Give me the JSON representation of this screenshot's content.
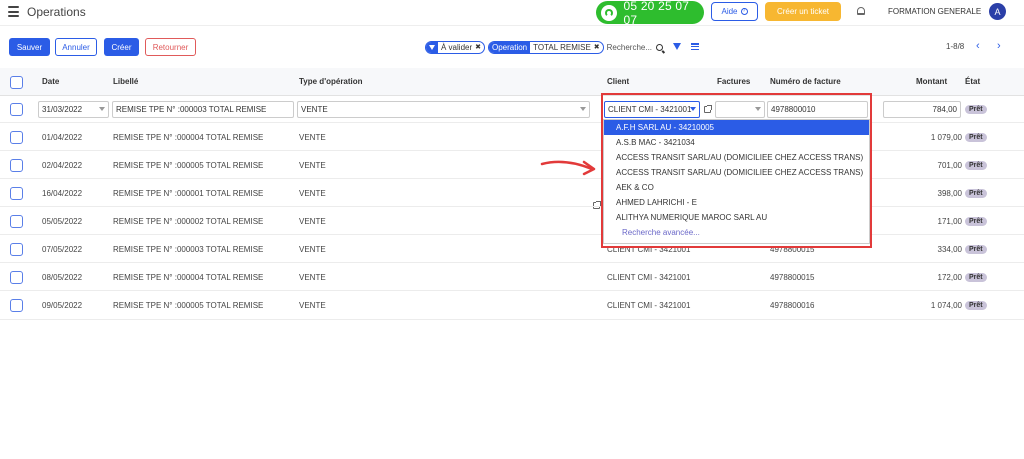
{
  "header": {
    "title": "Operations",
    "phone": "05 20 25 07 07",
    "help_label": "Aide",
    "ticket_label": "Créer un ticket",
    "company": "FORMATION GENERALE",
    "avatar_initial": "A"
  },
  "toolbar": {
    "save_label": "Sauver",
    "cancel_label": "Annuler",
    "create_label": "Créer",
    "return_label": "Retourner"
  },
  "search": {
    "filter_1": {
      "label": "À valider"
    },
    "filter_2": {
      "field": "Operation",
      "value": "TOTAL REMISE"
    },
    "placeholder": "Recherche..."
  },
  "pager": {
    "range": "1-8/8"
  },
  "columns": {
    "date": "Date",
    "libelle": "Libellé",
    "type": "Type d'opération",
    "client": "Client",
    "factures": "Factures",
    "numero": "Numéro de facture",
    "montant": "Montant",
    "etat": "État"
  },
  "edit_row": {
    "date": "31/03/2022",
    "libelle": "REMISE TPE N° :000003 TOTAL REMISE",
    "type": "VENTE",
    "client": "CLIENT CMI - 3421001",
    "factures": "",
    "numero": "4978800010",
    "montant": "784,00",
    "etat": "Prêt"
  },
  "rows": [
    {
      "date": "01/04/2022",
      "libelle": "REMISE TPE N° :000004 TOTAL REMISE",
      "type": "VENTE",
      "client": "",
      "numero": "",
      "montant": "1 079,00",
      "etat": "Prêt"
    },
    {
      "date": "02/04/2022",
      "libelle": "REMISE TPE N° :000005 TOTAL REMISE",
      "type": "VENTE",
      "client": "",
      "numero": "",
      "montant": "701,00",
      "etat": "Prêt"
    },
    {
      "date": "16/04/2022",
      "libelle": "REMISE TPE N° :000001 TOTAL REMISE",
      "type": "VENTE",
      "client": "",
      "numero": "",
      "montant": "398,00",
      "etat": "Prêt"
    },
    {
      "date": "05/05/2022",
      "libelle": "REMISE TPE N° :000002 TOTAL REMISE",
      "type": "VENTE",
      "client": "",
      "numero": "",
      "montant": "171,00",
      "etat": "Prêt"
    },
    {
      "date": "07/05/2022",
      "libelle": "REMISE TPE N° :000003 TOTAL REMISE",
      "type": "VENTE",
      "client": "CLIENT CMI - 3421001",
      "numero": "4978800015",
      "montant": "334,00",
      "etat": "Prêt"
    },
    {
      "date": "08/05/2022",
      "libelle": "REMISE TPE N° :000004 TOTAL REMISE",
      "type": "VENTE",
      "client": "CLIENT CMI - 3421001",
      "numero": "4978800015",
      "montant": "172,00",
      "etat": "Prêt"
    },
    {
      "date": "09/05/2022",
      "libelle": "REMISE TPE N° :000005 TOTAL REMISE",
      "type": "VENTE",
      "client": "CLIENT CMI - 3421001",
      "numero": "4978800016",
      "montant": "1 074,00",
      "etat": "Prêt"
    }
  ],
  "dropdown": {
    "options": [
      "A.F.H SARL AU - 34210005",
      "A.S.B MAC - 3421034",
      "ACCESS TRANSIT SARL/AU (DOMICILIEE CHEZ ACCESS TRANS)",
      "ACCESS TRANSIT SARL/AU (DOMICILIEE CHEZ ACCESS TRANS)",
      "AEK & CO",
      "AHMED LAHRICHI - E",
      "ALITHYA NUMERIQUE MAROC SARL AU"
    ],
    "advanced": "Recherche avancée..."
  },
  "colors": {
    "primary": "#2b5ce6",
    "phone_green": "#2ebd2e",
    "ticket_orange": "#f7b731",
    "highlight_red": "#e23a3a",
    "badge_bg": "#c9c3d9"
  }
}
